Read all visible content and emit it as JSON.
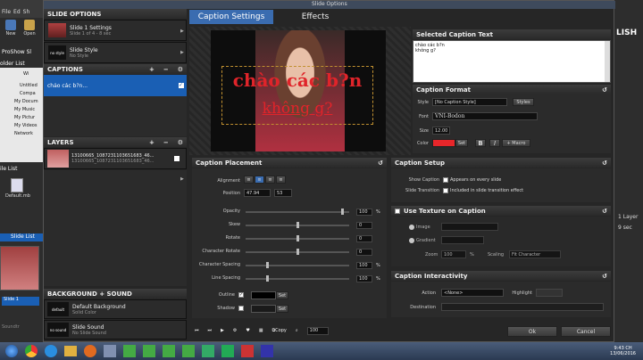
{
  "window": {
    "title": "Slide Options",
    "app_partial": "Pr",
    "left_menu": [
      "File",
      "Ed",
      "Sh"
    ],
    "right_label": "LISH",
    "prosh_label": "ProShow Sl",
    "folder_list": "older List",
    "slide_list": "Slide List",
    "layer_label": "1 Layer",
    "side_time": "9 sec",
    "file_name": "Default.mb",
    "left_icons": [
      "New",
      "Open"
    ],
    "folder_items": [
      "Wi",
      "Untitled",
      "Compa",
      "My Docum",
      "My Music",
      "My Pictur",
      "My Videos",
      "Network"
    ],
    "left_slide": "Slide 1",
    "seconds_label": "Soundtr"
  },
  "slide_options": {
    "header": "SLIDE OPTIONS",
    "item1_title": "Slide 1 Settings",
    "item1_sub": "Slide 1 of 4 - 8 sec",
    "item2_title": "Slide Style",
    "item2_sub": "No Style",
    "style_thumb": "no style"
  },
  "captions": {
    "header": "CAPTIONS",
    "item": "chảo các b?n..."
  },
  "layers": {
    "header": "LAYERS",
    "item": "13100665_1087231103651683_46...",
    "item_sub": "13100665_1087231103651683_46..."
  },
  "bg_sound": {
    "header": "BACKGROUND + SOUND",
    "bg_title": "Default Background",
    "bg_sub": "Solid Color",
    "bg_thumb": "default",
    "snd_title": "Slide Sound",
    "snd_sub": "No Slide Sound",
    "snd_thumb": "no sound"
  },
  "tabs": {
    "caption_settings": "Caption Settings",
    "effects": "Effects"
  },
  "preview": {
    "line1": "chào các b?n",
    "line2": "không g?"
  },
  "selected_caption": {
    "header": "Selected Caption Text",
    "text_line1": "chào các b?n",
    "text_line2": "không g?"
  },
  "caption_format": {
    "header": "Caption Format",
    "style_label": "Style",
    "style_value": "[No Caption Style]",
    "styles_btn": "Styles",
    "font_label": "Font",
    "font_value": "VNI-Bodon",
    "size_label": "Size",
    "size_value": "12.00",
    "color_label": "Color",
    "color_hex": "#e8262a",
    "set_btn": "Set",
    "bold": "B",
    "italic": "I",
    "macro_btn": "+ Macro"
  },
  "placement": {
    "header": "Caption Placement",
    "alignment_label": "Alignment",
    "position_label": "Position",
    "pos_x": "47.94",
    "pos_y": "53",
    "rows": [
      {
        "label": "Opacity",
        "value": "100",
        "unit": "%",
        "level": 0.95
      },
      {
        "label": "Skew",
        "value": "0",
        "unit": "",
        "level": 0.5
      },
      {
        "label": "Rotate",
        "value": "0",
        "unit": "",
        "level": 0.5
      },
      {
        "label": "Character Rotate",
        "value": "0",
        "unit": "",
        "level": 0.5
      },
      {
        "label": "Character Spacing",
        "value": "100",
        "unit": "%",
        "level": 0.2
      },
      {
        "label": "Line Spacing",
        "value": "100",
        "unit": "%",
        "level": 0.2
      }
    ],
    "outline_label": "Outline",
    "outline_set": "Set",
    "shadow_label": "Shadow",
    "shadow_set": "Set"
  },
  "setup": {
    "header": "Caption Setup",
    "show_caption_label": "Show Caption",
    "show_caption_opt": "Appears on every slide",
    "transition_label": "Slide Transition",
    "transition_opt": "Included in slide transition effect"
  },
  "texture": {
    "header": "Use Texture on Caption",
    "image_label": "Image",
    "gradient_label": "Gradient",
    "zoom_label": "Zoom",
    "zoom_value": "100",
    "zoom_unit": "%",
    "scaling_label": "Scaling",
    "scaling_value": "Fit Character"
  },
  "interactivity": {
    "header": "Caption Interactivity",
    "action_label": "Action",
    "action_value": "<None>",
    "highlight_label": "Highlight",
    "destination_label": "Destination"
  },
  "toolbar": {
    "copy_label": "Copy",
    "zoom_value": "100"
  },
  "footer": {
    "ok": "Ok",
    "cancel": "Cancel"
  },
  "taskbar": {
    "time": "9:43 CH",
    "date": "13/06/2016"
  }
}
